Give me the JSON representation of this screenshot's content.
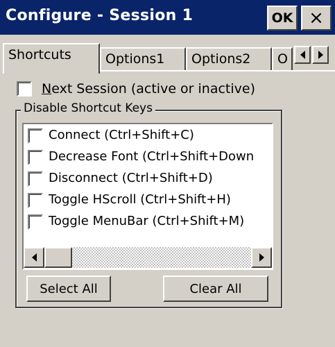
{
  "window": {
    "title": "Configure - Session 1",
    "ok_label": "OK",
    "close_glyph": "×"
  },
  "tabs": [
    {
      "label": "Shortcuts",
      "active": true
    },
    {
      "label": "Options1",
      "active": false
    },
    {
      "label": "Options2",
      "active": false
    },
    {
      "label": "O",
      "active": false
    }
  ],
  "next_session": {
    "label_mnemonic": "N",
    "label_rest": "ext Session (active or inactive)",
    "checked": false
  },
  "shortcut_group": {
    "legend": "Disable Shortcut Keys",
    "items": [
      {
        "label": "Connect (Ctrl+Shift+C)",
        "checked": false
      },
      {
        "label": "Decrease Font (Ctrl+Shift+Down",
        "checked": false
      },
      {
        "label": "Disconnect (Ctrl+Shift+D)",
        "checked": false
      },
      {
        "label": "Toggle HScroll (Ctrl+Shift+H)",
        "checked": false
      },
      {
        "label": "Toggle MenuBar (Ctrl+Shift+M)",
        "checked": false
      }
    ],
    "select_all_label": "Select All",
    "clear_all_label": "Clear All"
  },
  "colors": {
    "titlebar": "#0a246a",
    "face": "#d4d0c8"
  }
}
